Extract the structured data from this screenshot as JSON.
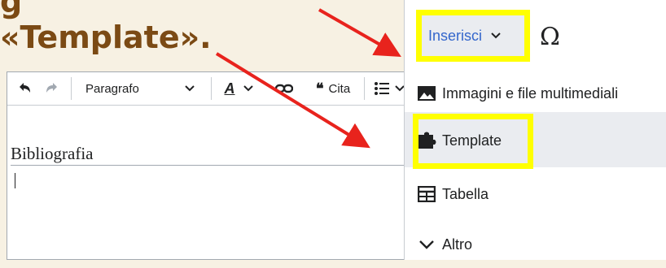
{
  "instruction": {
    "top_text": "g",
    "main_text": "«Template»."
  },
  "editor": {
    "toolbar": {
      "paragraph_label": "Paragrafo",
      "cite_label": "Cita"
    },
    "heading": "Bibliografia"
  },
  "menu": {
    "insert_label": "Inserisci",
    "special_char_glyph": "Ω",
    "items": [
      {
        "label": "Immagini e file multimediali",
        "icon": "image-icon"
      },
      {
        "label": "Template",
        "icon": "puzzle-icon"
      },
      {
        "label": "Tabella",
        "icon": "table-icon"
      },
      {
        "label": "Altro",
        "icon": "chevron-down-icon"
      }
    ]
  },
  "colors": {
    "background": "#f7f1e3",
    "instruction_text": "#7b4a14",
    "highlight": "#ffff00",
    "arrow": "#e8231d",
    "link": "#3366cc"
  }
}
